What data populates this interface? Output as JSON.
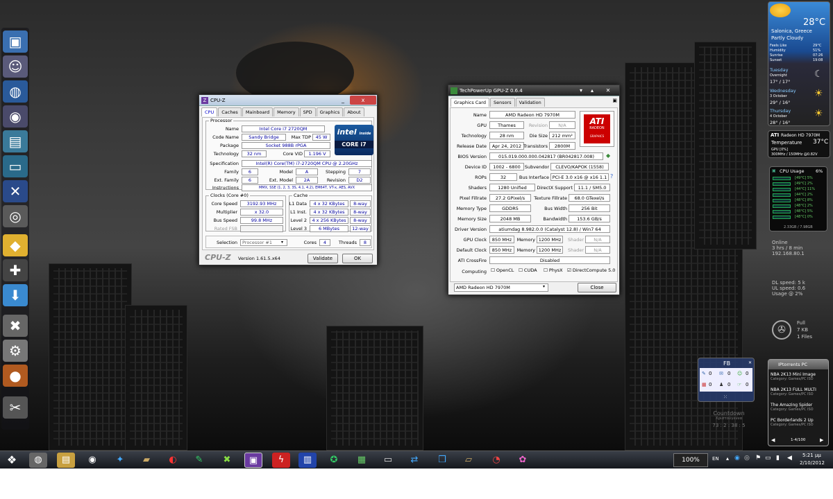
{
  "launcher": {
    "icons": [
      "computer-icon",
      "users-icon",
      "globe-icon",
      "camera-icon",
      "chart-icon",
      "monitor-icon",
      "tools-icon",
      "webcam-icon",
      "shield-icon",
      "gamepad-icon",
      "download-icon",
      "xbox-icon",
      "settings-icon",
      "media-icon",
      "wrench-icon"
    ]
  },
  "cpuz": {
    "title": "CPU-Z",
    "tabs": [
      "CPU",
      "Caches",
      "Mainboard",
      "Memory",
      "SPD",
      "Graphics",
      "About"
    ],
    "processor_legend": "Processor",
    "name_label": "Name",
    "name": "Intel Core i7 2720QM",
    "codename_label": "Code Name",
    "codename": "Sandy Bridge",
    "tdp_label": "Max TDP",
    "tdp": "45 W",
    "package_label": "Package",
    "package": "Socket 988B rPGA",
    "tech_label": "Technology",
    "tech": "32 nm",
    "vid_label": "Core VID",
    "vid": "1.196 V",
    "spec_label": "Specification",
    "spec": "Intel(R) Core(TM) i7-2720QM CPU @ 2.20GHz",
    "family_label": "Family",
    "family": "6",
    "model_label": "Model",
    "model": "A",
    "stepping_label": "Stepping",
    "stepping": "7",
    "extfamily_label": "Ext. Family",
    "extfamily": "6",
    "extmodel_label": "Ext. Model",
    "extmodel": "2A",
    "revision_label": "Revision",
    "revision": "D2",
    "instr_label": "Instructions",
    "instr": "MMX, SSE (1, 2, 3, 3S, 4.1, 4.2), EM64T, VT-x, AES, AVX",
    "logo_top": "intel",
    "logo_inside": "inside",
    "logo_bottom": "CORE i7",
    "clocks_legend": "Clocks (Core #0)",
    "corespeed_label": "Core Speed",
    "corespeed": "3192.93 MHz",
    "mult_label": "Multiplier",
    "mult": "x 32.0",
    "bus_label": "Bus Speed",
    "bus": "99.8 MHz",
    "fsb_label": "Rated FSB",
    "fsb": "",
    "cache_legend": "Cache",
    "l1d_label": "L1 Data",
    "l1d": "4 x 32 KBytes",
    "l1d_way": "8-way",
    "l1i_label": "L1 Inst.",
    "l1i": "4 x 32 KBytes",
    "l1i_way": "8-way",
    "l2_label": "Level 2",
    "l2": "4 x 256 KBytes",
    "l2_way": "8-way",
    "l3_label": "Level 3",
    "l3": "6 MBytes",
    "l3_way": "12-way",
    "selection_label": "Selection",
    "selection": "Processor #1",
    "cores_label": "Cores",
    "cores": "4",
    "threads_label": "Threads",
    "threads": "8",
    "brand": "CPU-Z",
    "version": "Version 1.61.5.x64",
    "validate": "Validate",
    "ok": "OK"
  },
  "gpuz": {
    "title": "TechPowerUp GPU-Z 0.6.4",
    "tabs": [
      "Graphics Card",
      "Sensors",
      "Validation"
    ],
    "name_label": "Name",
    "name": "AMD Radeon HD 7970M",
    "gpu_label": "GPU",
    "gpu": "Thames",
    "rev_label": "Revision",
    "rev": "N/A",
    "tech_label": "Technology",
    "tech": "28 nm",
    "die_label": "Die Size",
    "die": "212 mm²",
    "release_label": "Release Date",
    "release": "Apr 24, 2012",
    "trans_label": "Transistors",
    "trans": "2800M",
    "bios_label": "BIOS Version",
    "bios": "015.019.000.000.042817 (BR042817.008)",
    "devid_label": "Device ID",
    "devid": "1002 - 6800",
    "subv_label": "Subvendor",
    "subv": "CLEVO/KAPOK (1558)",
    "rops_label": "ROPs",
    "rops": "32",
    "busif_label": "Bus Interface",
    "busif": "PCI-E 3.0 x16 @ x16 1.1",
    "shaders_label": "Shaders",
    "shaders": "1280 Unified",
    "dx_label": "DirectX Support",
    "dx": "11.1 / SM5.0",
    "pixel_label": "Pixel Fillrate",
    "pixel": "27.2 GPixel/s",
    "tex_label": "Texture Fillrate",
    "tex": "68.0 GTexel/s",
    "memtype_label": "Memory Type",
    "memtype": "GDDR5",
    "buswidth_label": "Bus Width",
    "buswidth": "256 Bit",
    "memsize_label": "Memory Size",
    "memsize": "2048 MB",
    "bw_label": "Bandwidth",
    "bw": "153.6 GB/s",
    "driver_label": "Driver Version",
    "driver": "atiumdag 8.982.0.0 (Catalyst 12.8) / Win7 64",
    "gpuclock_label": "GPU Clock",
    "gpuclock": "850 MHz",
    "mem_label": "Memory",
    "memclock": "1200 MHz",
    "shader_label": "Shader",
    "shader": "N/A",
    "defclock_label": "Default Clock",
    "defclock": "850 MHz",
    "defmem": "1200 MHz",
    "defshader": "N/A",
    "crossfire_label": "ATI CrossFire",
    "crossfire": "Disabled",
    "computing_label": "Computing",
    "opencl": "OpenCL",
    "cuda": "CUDA",
    "physx": "PhysX",
    "dc": "DirectCompute 5.0",
    "card": "AMD Radeon HD 7970M",
    "close": "Close",
    "logo_brand": "ATI",
    "logo_line1": "RADEON",
    "logo_line2": "GRAPHICS"
  },
  "weather": {
    "temp": "28°C",
    "city": "Salonica, Greece",
    "cond": "Partly Cloudy",
    "feels_label": "Feels Like",
    "feels": "29°C",
    "hum_label": "Humidity",
    "hum": "51%",
    "sunrise_label": "Sunrise",
    "sunrise": "07:26",
    "sunset_label": "Sunset",
    "sunset": "19:08",
    "days": [
      {
        "day": "Tuesday",
        "sub": "Overnight",
        "range": "17° / 17°"
      },
      {
        "day": "Wednesday",
        "sub": "3 October",
        "range": "29° / 16°"
      },
      {
        "day": "Thursday",
        "sub": "4 October",
        "range": "28° / 16°"
      }
    ]
  },
  "gpumon": {
    "name": "Radeon HD 7970M",
    "temp_label": "Temperature",
    "temp": "37°C",
    "line1": "GPU [0%]",
    "line2": "300MHz / 150MHz  @0.82V"
  },
  "cpumon": {
    "title": "CPU Usage",
    "total": "6%",
    "rows": [
      "[49°C]  5%",
      "[49°C]  2%",
      "[44°C]  11%",
      "[44°C]  2%",
      "[48°C]  8%",
      "[48°C]  2%",
      "[48°C]  5%",
      "[48°C]  0%"
    ],
    "mem": "2.33GB / 7.98GB"
  },
  "net": {
    "status": "Online",
    "uptime": "3 hrs / 8 min",
    "ip": "192.168.80.1",
    "dl": "DL speed: 5 k",
    "ul": "UL speed: 0.6",
    "usage": "Usage @ 2%"
  },
  "recycle": {
    "state": "Full",
    "size": "7 KB",
    "files": "1 Files"
  },
  "fb": {
    "title": "FB",
    "n1": "0",
    "n2": "0",
    "n3": "0",
    "n4": "0",
    "n5": "0",
    "n6": "0"
  },
  "countdown": {
    "title": "Countdown",
    "sub": "Χριστούγεννα",
    "nums": "73 : 2 : 38 : 5"
  },
  "torrents": {
    "title": "IPtorrents PC",
    "items": [
      {
        "name": "NBA 2K13 Mini Image",
        "cat": "Category: Games/PC ISO"
      },
      {
        "name": "NBA 2K13 FULL MULTI",
        "cat": "Category: Games/PC ISO"
      },
      {
        "name": "The Amazing Spider",
        "cat": "Category: Games/PC ISO"
      },
      {
        "name": "PC Borderlands 2 Up",
        "cat": "Category: Games/PC ISO"
      }
    ],
    "page": "1-4/100"
  },
  "taskbar": {
    "zoom": "100%",
    "lang": "EN",
    "time": "5:21 μμ",
    "date": "2/10/2012"
  }
}
